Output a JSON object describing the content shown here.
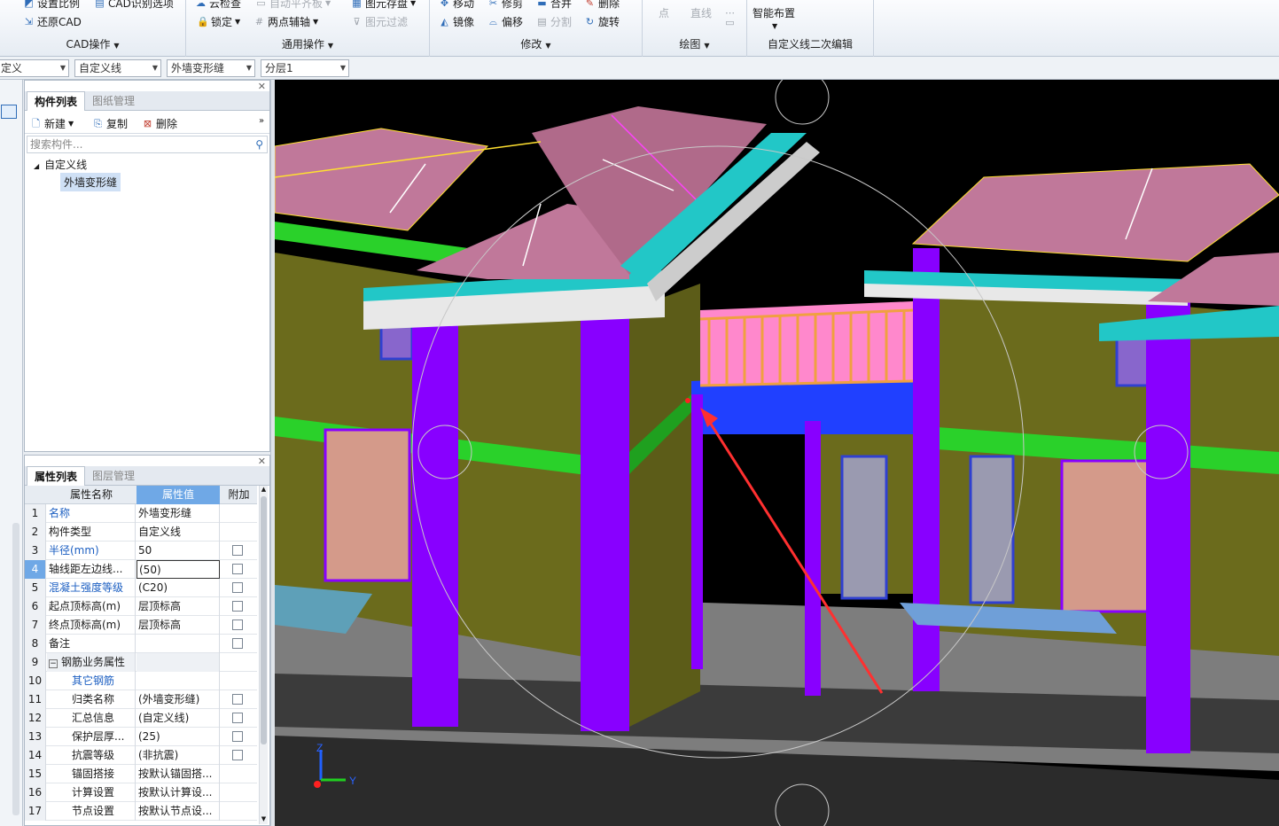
{
  "ribbon": {
    "cad_ops": {
      "set_scale": "设置比例",
      "cad_recog_options": "CAD识别选项",
      "restore_cad": "还原CAD",
      "group_label": "CAD操作"
    },
    "general_ops": {
      "cloud_check": "云检查",
      "auto_slab": "自动平齐板",
      "element_store": "图元存盘",
      "lock": "锁定",
      "two_point_axis": "两点辅轴",
      "element_filter": "图元过滤",
      "group_label": "通用操作"
    },
    "modify": {
      "move": "移动",
      "trim": "修剪",
      "merge": "合并",
      "delete": "删除",
      "mirror": "镜像",
      "offset": "偏移",
      "split": "分割",
      "rotate": "旋转",
      "group_label": "修改"
    },
    "draw": {
      "point": "点",
      "line": "直线",
      "group_label": "绘图"
    },
    "custom_line_edit": {
      "smart_place": "智能布置",
      "group_label": "自定义线二次编辑"
    }
  },
  "toolbar2": {
    "combo1": "定义",
    "combo2": "自定义线",
    "combo3": "外墙变形缝",
    "combo4": "分层1"
  },
  "component_panel": {
    "tabs": [
      "构件列表",
      "图纸管理"
    ],
    "new_btn": "新建",
    "copy_btn": "复制",
    "delete_btn": "删除",
    "search_placeholder": "搜索构件...",
    "tree_root": "自定义线",
    "tree_child": "外墙变形缝"
  },
  "property_panel": {
    "tabs": [
      "属性列表",
      "图层管理"
    ],
    "headers": {
      "name": "属性名称",
      "value": "属性值",
      "extra": "附加"
    },
    "rows": [
      {
        "n": "1",
        "name": "名称",
        "value": "外墙变形缝"
      },
      {
        "n": "2",
        "name": "构件类型",
        "value": "自定义线"
      },
      {
        "n": "3",
        "name": "半径(mm)",
        "value": "50"
      },
      {
        "n": "4",
        "name": "轴线距左边线...",
        "value": "(50)"
      },
      {
        "n": "5",
        "name": "混凝土强度等级",
        "value": "(C20)"
      },
      {
        "n": "6",
        "name": "起点顶标高(m)",
        "value": "层顶标高"
      },
      {
        "n": "7",
        "name": "终点顶标高(m)",
        "value": "层顶标高"
      },
      {
        "n": "8",
        "name": "备注",
        "value": ""
      },
      {
        "n": "9",
        "name": "钢筋业务属性",
        "value": ""
      },
      {
        "n": "10",
        "name": "其它钢筋",
        "value": ""
      },
      {
        "n": "11",
        "name": "归类名称",
        "value": "(外墙变形缝)"
      },
      {
        "n": "12",
        "name": "汇总信息",
        "value": "(自定义线)"
      },
      {
        "n": "13",
        "name": "保护层厚...",
        "value": "(25)"
      },
      {
        "n": "14",
        "name": "抗震等级",
        "value": "(非抗震)"
      },
      {
        "n": "15",
        "name": "锚固搭接",
        "value": "按默认锚固搭..."
      },
      {
        "n": "16",
        "name": "计算设置",
        "value": "按默认计算设..."
      },
      {
        "n": "17",
        "name": "节点设置",
        "value": "按默认节点设..."
      }
    ]
  },
  "viewport": {
    "axis_z": "Z",
    "axis_y": "Y",
    "colors": {
      "wall": "#6b6b1c",
      "column": "#8800ff",
      "roof": "#c0789a",
      "band": "#2ad12a",
      "eave": "#22c7c7",
      "railing": "#f0a040"
    }
  }
}
